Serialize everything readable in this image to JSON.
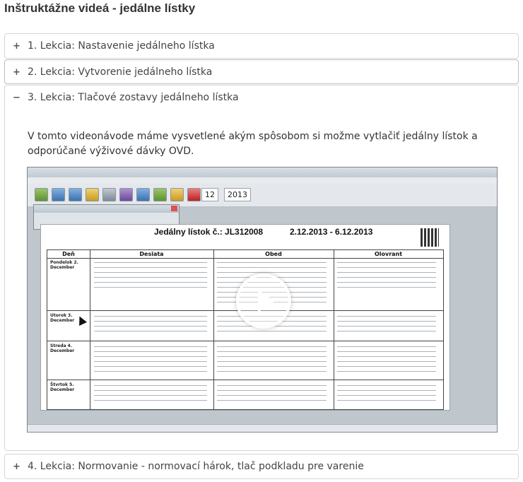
{
  "page_title": "Inštruktážne videá - jedálne lístky",
  "lessons": [
    {
      "icon": "+",
      "label": "1. Lekcia: Nastavenie jedálneho lístka",
      "expanded": false
    },
    {
      "icon": "+",
      "label": "2. Lekcia: Vytvorenie jedálneho lístka",
      "expanded": false
    },
    {
      "icon": "−",
      "label": "3. Lekcia: Tlačové zostavy jedálneho lístka",
      "expanded": true,
      "description": "V tomto videonávode máme vysvetlené akým spôsobom si možme vytlačiť jedálny lístok a odporúčané výživové dávky OVD."
    },
    {
      "icon": "+",
      "label": "4. Lekcia: Normovanie - normovací hárok, tlač podkladu pre varenie",
      "expanded": false
    }
  ],
  "video": {
    "report_title": "Jedálny lístok č.: JL312008",
    "report_dates": "2.12.2013 - 6.12.2013",
    "toolbar_month": "12",
    "toolbar_year": "2013",
    "columns": [
      "Deň",
      "Desiata",
      "Obed",
      "Olovrant"
    ],
    "days": [
      "Pondelok 2. December",
      "Utorok 3. December",
      "Streda 4. December",
      "Štvrtok 5. December"
    ],
    "play_icon": "play-icon"
  }
}
